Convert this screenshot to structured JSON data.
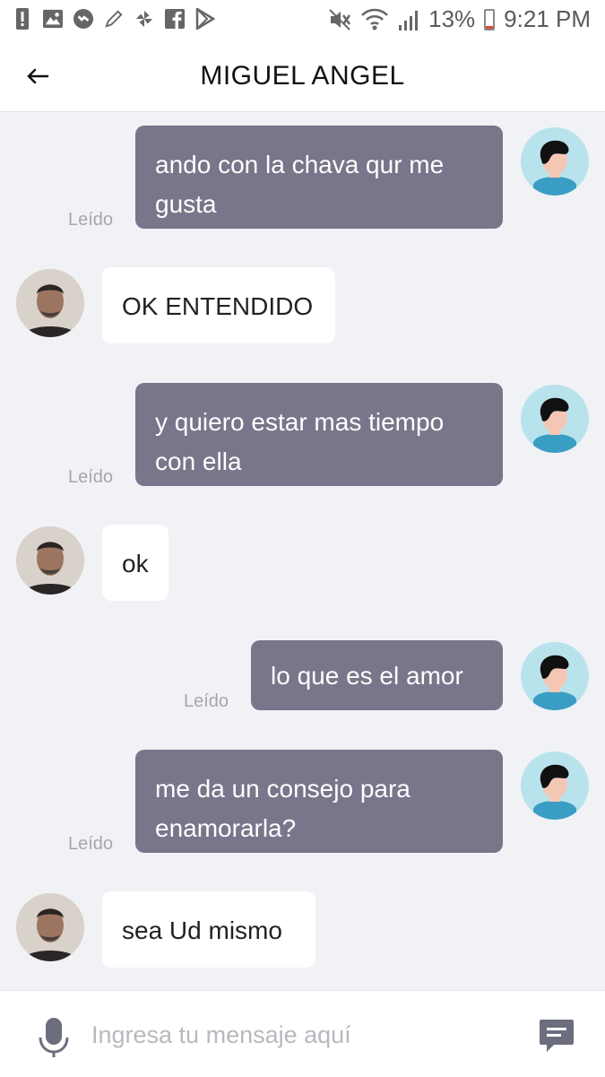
{
  "status_bar": {
    "battery": "13%",
    "time": "9:21 PM",
    "battery_level": 0.13,
    "left_icons": [
      "alert-icon",
      "gallery-icon",
      "messenger-icon",
      "pen-icon",
      "pinwheel-icon",
      "facebook-icon",
      "play-store-icon"
    ],
    "right_icons": [
      "mute-icon",
      "wifi-icon",
      "signal-icon",
      "battery-icon"
    ]
  },
  "header": {
    "title": "MIGUEL ANGEL",
    "back_icon": "arrow-left-icon"
  },
  "messages": [
    {
      "direction": "out",
      "lines": [
        "ando con la chava qur me",
        "gusta"
      ],
      "status": "Leído"
    },
    {
      "direction": "in",
      "lines": [
        "OK ENTENDIDO"
      ]
    },
    {
      "direction": "out",
      "lines": [
        "y quiero estar mas tiempo",
        "con ella"
      ],
      "status": "Leído"
    },
    {
      "direction": "in",
      "lines": [
        "ok"
      ]
    },
    {
      "direction": "out",
      "lines": [
        "lo que es el amor"
      ],
      "status": "Leído"
    },
    {
      "direction": "out",
      "lines": [
        "me da un consejo para",
        "enamorarla?"
      ],
      "status": "Leído"
    },
    {
      "direction": "in",
      "lines": [
        "sea Ud mismo"
      ]
    }
  ],
  "input": {
    "placeholder": "Ingresa tu mensaje aquí",
    "value": "",
    "mic_icon": "microphone-icon",
    "send_icon": "message-send-icon"
  },
  "colors": {
    "outgoing_bubble": "#77768a",
    "incoming_bubble": "#ffffff",
    "chat_background": "#f1f2f6",
    "my_avatar_bg": "#b9e3ec"
  }
}
